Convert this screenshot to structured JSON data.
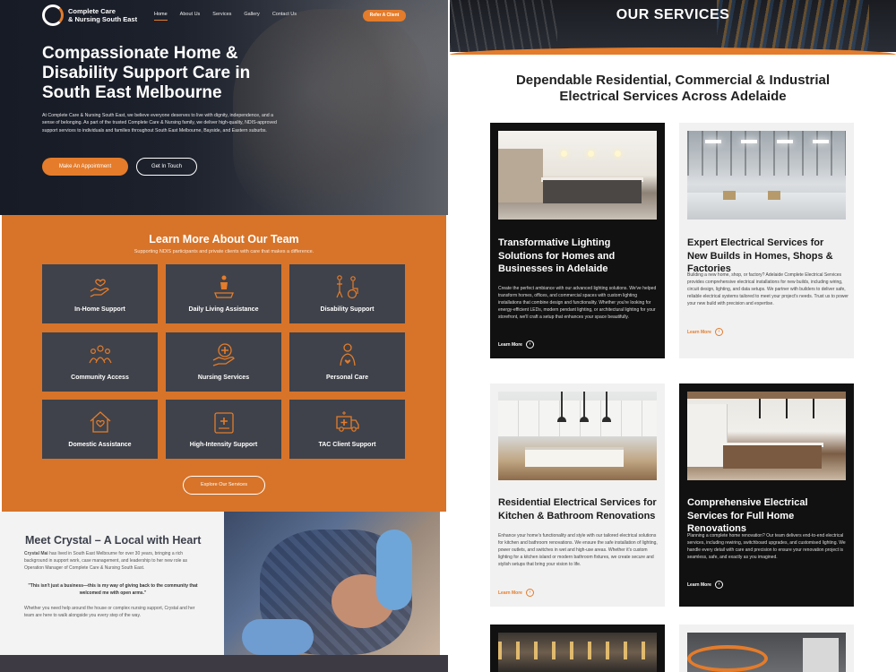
{
  "left": {
    "brand": {
      "line1": "Complete Care",
      "line2": "& Nursing South East"
    },
    "nav": {
      "links": [
        "Home",
        "About Us",
        "Services",
        "Gallery",
        "Contact Us"
      ],
      "active": "Home",
      "cta": "Refer A Client"
    },
    "hero": {
      "title": "Compassionate Home & Disability Support Care in South East Melbourne",
      "description": "At Complete Care & Nursing South East, we believe everyone deserves to live with dignity, independence, and a sense of belonging. As part of the trusted Complete Care & Nursing family, we deliver high-quality, NDIS-approved support services to individuals and families throughout South East Melbourne, Bayside, and Eastern suburbs.",
      "primary_button": "Make An Appointment",
      "secondary_button": "Get In Touch"
    },
    "team": {
      "title": "Learn More About Our Team",
      "subtitle": "Supporting NDIS participants and private clients with care that makes a difference.",
      "services": [
        {
          "label": "In-Home Support",
          "icon": "hand-heart-icon"
        },
        {
          "label": "Daily Living Assistance",
          "icon": "person-helping-icon"
        },
        {
          "label": "Disability Support",
          "icon": "wheelchair-icon"
        },
        {
          "label": "Community Access",
          "icon": "community-group-icon"
        },
        {
          "label": "Nursing Services",
          "icon": "medical-cross-hand-icon"
        },
        {
          "label": "Personal Care",
          "icon": "person-care-icon"
        },
        {
          "label": "Domestic Assistance",
          "icon": "home-heart-icon"
        },
        {
          "label": "High-Intensity Support",
          "icon": "medical-report-icon"
        },
        {
          "label": "TAC Client Support",
          "icon": "ambulance-icon"
        }
      ],
      "explore_button": "Explore Our Services"
    },
    "crystal": {
      "title": "Meet Crystal – A Local with Heart",
      "name": "Crystal Mai",
      "intro": " has lived in South East Melbourne for over 30 years, bringing a rich background in support work, case management, and leadership to her new role as Operation Manager of Complete Care & Nursing South East.",
      "quote": "\"This isn't just a business—this is my way of giving back to the community that welcomed me with open arms.\"",
      "closing": "Whether you need help around the house or complex nursing support, Crystal and her team are here to walk alongside you every step of the way."
    }
  },
  "right": {
    "banner_title": "OUR SERVICES",
    "heading": "Dependable Residential, Commercial & Industrial Electrical Services Across Adelaide",
    "cards": [
      {
        "title": "Transformative Lighting Solutions for Homes and Businesses in Adelaide",
        "description": "Create the perfect ambiance with our advanced lighting solutions. We've helped transform homes, offices, and commercial spaces with custom lighting installations that combine design and functionality. Whether you're looking for energy-efficient LEDs, modern pendant lighting, or architectural lighting for your storefront, we'll craft a setup that enhances your space beautifully.",
        "link": "Learn More"
      },
      {
        "title": "Expert Electrical Services for New Builds in Homes, Shops & Factories",
        "description": "Building a new home, shop, or factory? Adelaide Complete Electrical Services provides comprehensive electrical installations for new builds, including wiring, circuit design, lighting, and data setups. We partner with builders to deliver safe, reliable electrical systems tailored to meet your project's needs. Trust us to power your new build with precision and expertise.",
        "link": "Learn More"
      },
      {
        "title": "Residential Electrical Services for Kitchen & Bathroom Renovations",
        "description": "Enhance your home's functionality and style with our tailored electrical solutions for kitchen and bathroom renovations. We ensure the safe installation of lighting, power outlets, and switches in wet and high-use areas. Whether it's custom lighting for a kitchen island or modern bathroom fixtures, we create secure and stylish setups that bring your vision to life.",
        "link": "Learn More"
      },
      {
        "title": "Comprehensive Electrical Services for Full Home Renovations",
        "description": "Planning a complete home renovation? Our team delivers end-to-end electrical services, including rewiring, switchboard upgrades, and customised lighting. We handle every detail with care and precision to ensure your renovation project is seamless, safe, and exactly as you imagined.",
        "link": "Learn More"
      }
    ]
  },
  "colors": {
    "accent": "#e47c2b",
    "tile": "#3f424a",
    "dark_card": "#111111",
    "light_card": "#f1f1f1"
  }
}
